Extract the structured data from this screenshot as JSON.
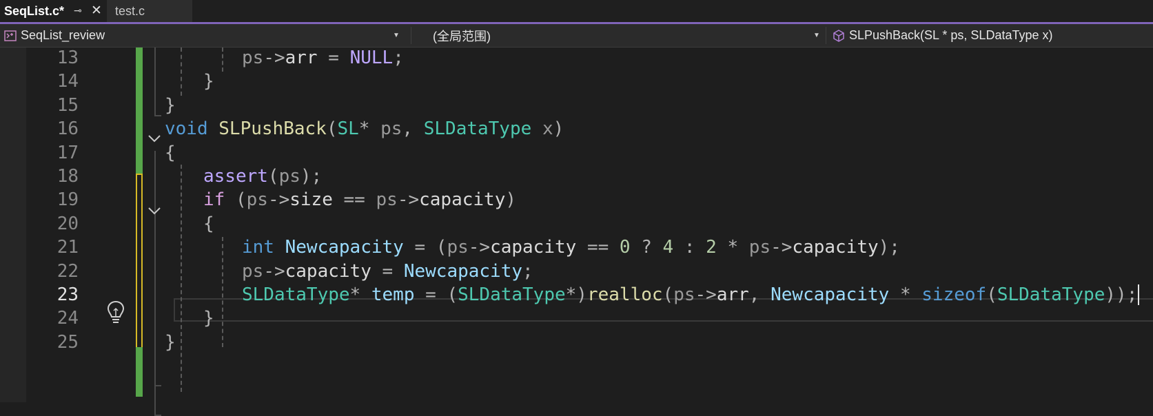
{
  "tabs": [
    {
      "label": "SeqList.c*",
      "active": true
    },
    {
      "label": "test.c",
      "active": false
    }
  ],
  "navbar": {
    "project": "SeqList_review",
    "scope": "(全局范围)",
    "member": "SLPushBack(SL * ps, SLDataType x)"
  },
  "editor": {
    "current_line": 23,
    "line_numbers": [
      "13",
      "14",
      "15",
      "16",
      "17",
      "18",
      "19",
      "20",
      "21",
      "22",
      "23",
      "24",
      "25"
    ],
    "lines": [
      [
        [
          "ps",
          "param"
        ],
        [
          "->",
          "punc"
        ],
        [
          "arr",
          "mem"
        ],
        [
          " = ",
          "punc"
        ],
        [
          "NULL",
          "mac"
        ],
        [
          ";",
          "punc"
        ]
      ],
      [
        [
          "}",
          "punc"
        ]
      ],
      [
        [
          "}",
          "punc"
        ]
      ],
      [
        [
          "void",
          "kw"
        ],
        [
          " ",
          "punc"
        ],
        [
          "SLPushBack",
          "fn"
        ],
        [
          "(",
          "punc"
        ],
        [
          "SL",
          "type"
        ],
        [
          "* ",
          "punc"
        ],
        [
          "ps",
          "param"
        ],
        [
          ", ",
          "punc"
        ],
        [
          "SLDataType",
          "type"
        ],
        [
          " ",
          "punc"
        ],
        [
          "x",
          "param"
        ],
        [
          ")",
          "punc"
        ]
      ],
      [
        [
          "{",
          "punc"
        ]
      ],
      [
        [
          "assert",
          "mac"
        ],
        [
          "(",
          "punc"
        ],
        [
          "ps",
          "param"
        ],
        [
          ");",
          "punc"
        ]
      ],
      [
        [
          "if",
          "ctrl"
        ],
        [
          " (",
          "punc"
        ],
        [
          "ps",
          "param"
        ],
        [
          "->",
          "punc"
        ],
        [
          "size",
          "mem"
        ],
        [
          " == ",
          "punc"
        ],
        [
          "ps",
          "param"
        ],
        [
          "->",
          "punc"
        ],
        [
          "capacity",
          "mem"
        ],
        [
          ")",
          "punc"
        ]
      ],
      [
        [
          "{",
          "punc"
        ]
      ],
      [
        [
          "int",
          "kw"
        ],
        [
          " ",
          "punc"
        ],
        [
          "Newcapacity",
          "local"
        ],
        [
          " = (",
          "punc"
        ],
        [
          "ps",
          "param"
        ],
        [
          "->",
          "punc"
        ],
        [
          "capacity",
          "mem"
        ],
        [
          " == ",
          "punc"
        ],
        [
          "0",
          "num"
        ],
        [
          " ? ",
          "punc"
        ],
        [
          "4",
          "num"
        ],
        [
          " : ",
          "punc"
        ],
        [
          "2",
          "num"
        ],
        [
          " * ",
          "punc"
        ],
        [
          "ps",
          "param"
        ],
        [
          "->",
          "punc"
        ],
        [
          "capacity",
          "mem"
        ],
        [
          ");",
          "punc"
        ]
      ],
      [
        [
          "ps",
          "param"
        ],
        [
          "->",
          "punc"
        ],
        [
          "capacity",
          "mem"
        ],
        [
          " = ",
          "punc"
        ],
        [
          "Newcapacity",
          "local"
        ],
        [
          ";",
          "punc"
        ]
      ],
      [
        [
          "SLDataType",
          "type"
        ],
        [
          "* ",
          "punc"
        ],
        [
          "temp",
          "local"
        ],
        [
          " = (",
          "punc"
        ],
        [
          "SLDataType",
          "type"
        ],
        [
          "*)",
          "punc"
        ],
        [
          "realloc",
          "fn"
        ],
        [
          "(",
          "punc"
        ],
        [
          "ps",
          "param"
        ],
        [
          "->",
          "punc"
        ],
        [
          "arr",
          "mem"
        ],
        [
          ", ",
          "punc"
        ],
        [
          "Newcapacity",
          "local"
        ],
        [
          " * ",
          "punc"
        ],
        [
          "sizeof",
          "kw"
        ],
        [
          "(",
          "punc"
        ],
        [
          "SLDataType",
          "type"
        ],
        [
          "));",
          "punc"
        ]
      ],
      [
        [
          "}",
          "punc"
        ]
      ],
      [
        [
          "}",
          "punc"
        ]
      ]
    ]
  }
}
